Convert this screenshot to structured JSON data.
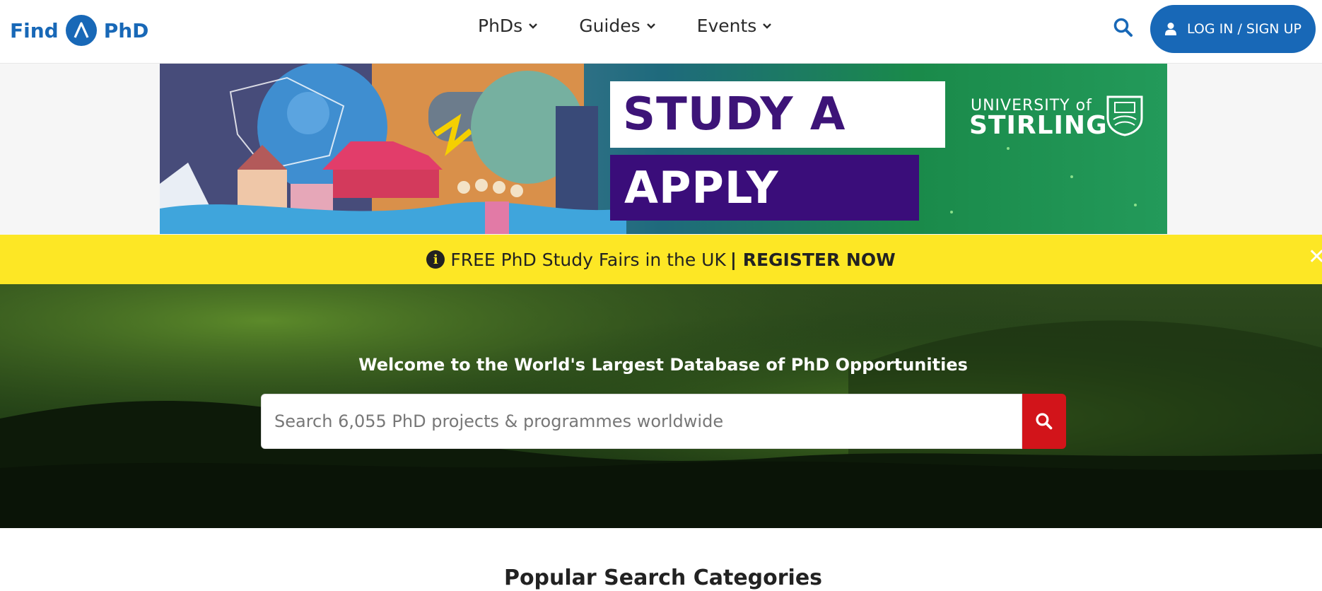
{
  "logo": {
    "left_word": "Find",
    "right_word": "PhD",
    "mark_glyph": "Λ",
    "icon": "findaphd-logo-icon"
  },
  "nav": {
    "items": [
      {
        "label": "PhDs",
        "icon": "chevron-down-icon"
      },
      {
        "label": "Guides",
        "icon": "chevron-down-icon"
      },
      {
        "label": "Events",
        "icon": "chevron-down-icon"
      }
    ],
    "search_icon": "search-icon",
    "login_label": "LOG IN / SIGN UP",
    "login_icon": "user-icon"
  },
  "ad": {
    "line1": "STUDY A PhD",
    "line2": "APPLY NOW",
    "university_top": "UNIVERSITY of",
    "university_bottom": "STIRLING",
    "crest_icon": "university-crest-icon"
  },
  "notice": {
    "icon": "info-icon",
    "info_glyph": "i",
    "text": "FREE PhD Study Fairs in the UK",
    "link_label": "| REGISTER NOW",
    "close_glyph": "✕"
  },
  "hero": {
    "title": "Welcome to the World's Largest Database of PhD Opportunities",
    "search_placeholder": "Search 6,055 PhD projects & programmes worldwide",
    "search_value": ""
  },
  "section": {
    "title": "Popular Search Categories"
  },
  "colors": {
    "brand_blue": "#1868b7",
    "notice_yellow": "#fde725",
    "search_red": "#d2141a",
    "ad_purple": "#3a0d7a"
  }
}
